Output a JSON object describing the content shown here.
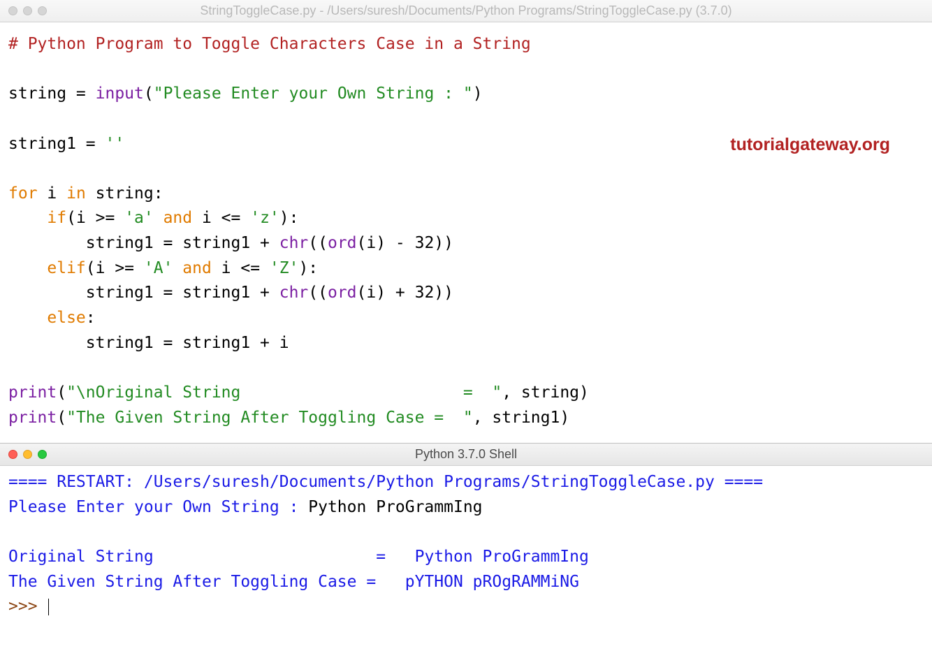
{
  "editor_window": {
    "title": "StringToggleCase.py - /Users/suresh/Documents/Python Programs/StringToggleCase.py (3.7.0)",
    "code": {
      "line1_comment": "# Python Program to Toggle Characters Case in a String",
      "line3_var": "string = ",
      "line3_func": "input",
      "line3_paren_open": "(",
      "line3_str": "\"Please Enter your Own String : \"",
      "line3_paren_close": ")",
      "line5_assign": "string1 = ",
      "line5_str": "''",
      "line7_for": "for",
      "line7_mid": " i ",
      "line7_in": "in",
      "line7_end": " string:",
      "line8_indent": "    ",
      "line8_if": "if",
      "line8_paren": "(i >= ",
      "line8_str1": "'a'",
      "line8_and": " and",
      "line8_mid2": " i <= ",
      "line8_str2": "'z'",
      "line8_end": "):",
      "line9_indent": "        string1 = string1 + ",
      "line9_chr": "chr",
      "line9_p1": "((",
      "line9_ord": "ord",
      "line9_p2": "(i) - 32))",
      "line10_indent": "    ",
      "line10_elif": "elif",
      "line10_paren": "(i >= ",
      "line10_str1": "'A'",
      "line10_and": " and",
      "line10_mid2": " i <= ",
      "line10_str2": "'Z'",
      "line10_end": "):",
      "line11_indent": "        string1 = string1 + ",
      "line11_chr": "chr",
      "line11_p1": "((",
      "line11_ord": "ord",
      "line11_p2": "(i) + 32))",
      "line12_indent": "    ",
      "line12_else": "else",
      "line12_end": ":",
      "line13": "        string1 = string1 + i",
      "line15_print": "print",
      "line15_p": "(",
      "line15_str": "\"\\nOriginal String                       =  \"",
      "line15_end": ", string)",
      "line16_print": "print",
      "line16_p": "(",
      "line16_str": "\"The Given String After Toggling Case =  \"",
      "line16_end": ", string1)"
    }
  },
  "watermark": "tutorialgateway.org",
  "shell_window": {
    "title": "Python 3.7.0 Shell",
    "content": {
      "restart_line": "==== RESTART: /Users/suresh/Documents/Python Programs/StringToggleCase.py ====",
      "prompt_text": "Please Enter your Own String : ",
      "user_input": "Python ProGrammIng",
      "out1_label": "Original String                       =   ",
      "out1_value": "Python ProGrammIng",
      "out2_label": "The Given String After Toggling Case =   ",
      "out2_value": "pYTHON pROgRAMMiNG",
      "prompt": ">>> "
    }
  }
}
